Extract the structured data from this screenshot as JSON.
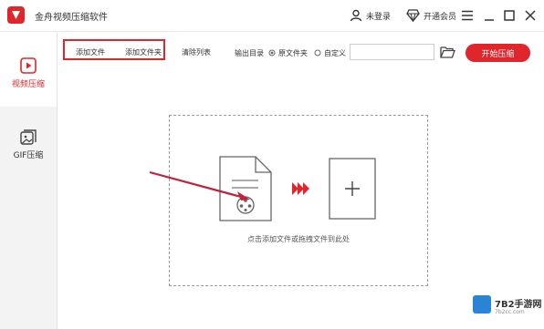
{
  "app": {
    "title": "金舟视频压缩软件",
    "login_label": "未登录",
    "vip_label": "开通会员"
  },
  "sidebar": {
    "items": [
      {
        "label": "视频压缩",
        "icon": "video-play-icon",
        "active": true
      },
      {
        "label": "GIF压缩",
        "icon": "gif-image-icon",
        "active": false
      }
    ]
  },
  "toolbar": {
    "add_file_label": "添加文件",
    "add_folder_label": "添加文件夹",
    "clear_list_label": "清除列表",
    "output_dir_label": "输出目录",
    "original_folder_label": "原文件夹",
    "custom_label": "自定义",
    "output_path_value": "",
    "start_label": "开始压缩"
  },
  "dropzone": {
    "hint": "点击添加文件或拖拽文件到此处"
  },
  "watermark": {
    "brand": "7B2手游网",
    "url": "7b2cc.com"
  },
  "colors": {
    "accent": "#e0252b",
    "sidebar_bg": "#f3f3f3",
    "border": "#9a9a9a"
  }
}
